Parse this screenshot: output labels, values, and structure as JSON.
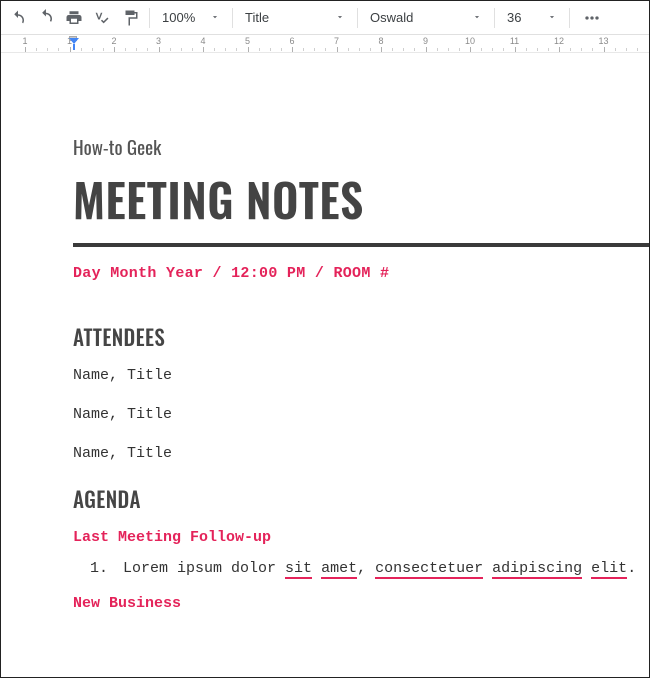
{
  "toolbar": {
    "zoom": "100%",
    "paragraph_style": "Title",
    "font": "Oswald",
    "font_size": "36"
  },
  "ruler": {
    "numbers": [
      "1",
      "1",
      "2",
      "3",
      "4",
      "5",
      "6",
      "7",
      "8",
      "9",
      "10",
      "11",
      "12",
      "13"
    ]
  },
  "doc": {
    "pre_title": "How-to Geek",
    "title": "MEETING NOTES",
    "meta": "Day Month Year / 12:00 PM / ROOM #",
    "attendees_heading": "ATTENDEES",
    "attendees": [
      "Name, Title",
      "Name, Title",
      "Name, Title"
    ],
    "agenda_heading": "AGENDA",
    "agenda": {
      "last_meeting_label": "Last Meeting Follow-up",
      "item1_prefix": "Lorem ipsum dolor ",
      "item1_words": [
        "sit",
        "amet",
        "consectetuer",
        "adipiscing",
        "elit"
      ],
      "item1_sep_comma": ", ",
      "item1_sep_space": " ",
      "item1_period": ".",
      "new_business_label": "New Business"
    }
  }
}
